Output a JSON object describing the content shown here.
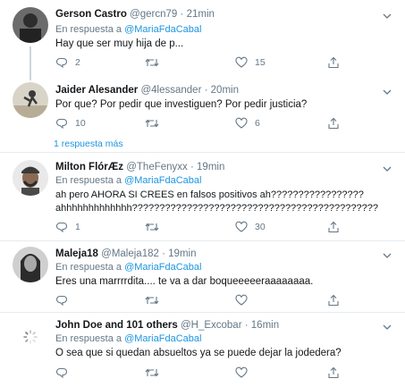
{
  "tweets": [
    {
      "name": "Gerson Castro",
      "handle": "@gercn79",
      "time": "21min",
      "reply_prefix": "En respuesta a",
      "reply_to": "@MariaFdaCabal",
      "lines": [
        "Hay que ser muy hija de p..."
      ],
      "replies": "2",
      "retweets": "",
      "likes": "15"
    },
    {
      "name": "Jaider Alesander",
      "handle": "@4lessander",
      "time": "20min",
      "lines": [
        "Por que? Por pedir que investiguen? Por pedir justicia?"
      ],
      "replies": "10",
      "retweets": "",
      "likes": "6"
    },
    {
      "name": "Milton FlórÆz",
      "handle": "@TheFenyxx",
      "time": "19min",
      "reply_prefix": "En respuesta a",
      "reply_to": "@MariaFdaCabal",
      "lines": [
        "ah pero AHORA SI CREES en falsos positivos ah?????????????????",
        "ahhhhhhhhhhhhh?????????????????????????????????????????????"
      ],
      "replies": "1",
      "retweets": "",
      "likes": "30"
    },
    {
      "name": "Maleja18",
      "handle": "@Maleja182",
      "time": "19min",
      "reply_prefix": "En respuesta a",
      "reply_to": "@MariaFdaCabal",
      "lines": [
        "Eres una marrrrdita.... te va a dar boqueeeeeraaaaaaaa."
      ],
      "replies": "",
      "retweets": "",
      "likes": ""
    },
    {
      "name": "John Doe and 101 others",
      "handle": "@H_Excobar",
      "time": "16min",
      "reply_prefix": "En respuesta a",
      "reply_to": "@MariaFdaCabal",
      "lines": [
        "O sea que si quedan absueltos ya se puede dejar la jodedera?"
      ],
      "replies": "",
      "retweets": "",
      "likes": ""
    }
  ],
  "more_replies": "1 respuesta más",
  "dot": "·"
}
